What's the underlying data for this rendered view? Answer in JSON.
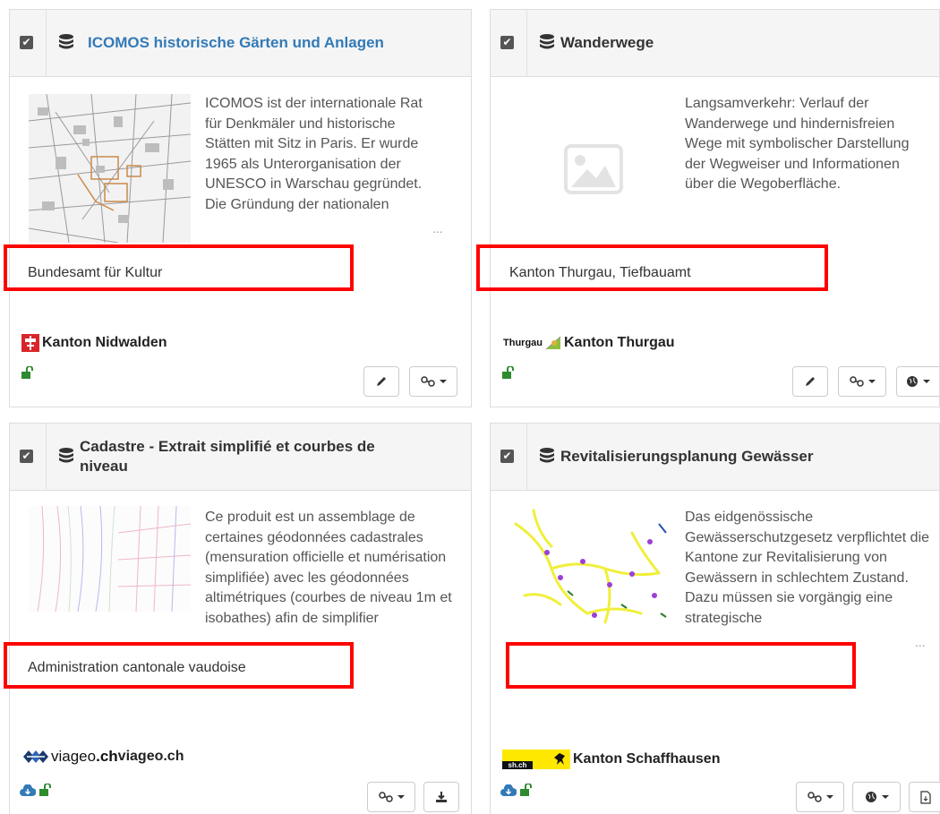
{
  "cards": [
    {
      "title": "ICOMOS historische Gärten und Anlagen",
      "description": "ICOMOS ist der internationale Rat für Denkmäler und historische Stätten mit Sitz in Paris. Er wurde 1965 als Unterorganisation der UNESCO in Warschau gegründet. Die Gründung der nationalen",
      "ellipsis": "...",
      "publisher": "Bundesamt für Kultur",
      "organization": "Kanton Nidwalden"
    },
    {
      "title": "Wanderwege",
      "description": "Langsamverkehr: Verlauf der Wanderwege und hindernisfreien Wege mit symbolischer Darstellung der Wegweiser und Informationen über die Wegoberfläche.",
      "publisher": "Kanton Thurgau, Tiefbauamt",
      "organization_logo_text": "Thurgau",
      "organization": "Kanton Thurgau"
    },
    {
      "title": "Cadastre - Extrait simplifié et courbes de niveau",
      "description": "Ce produit est un assemblage de certaines géodonnées cadastrales (mensuration officielle et numérisation simplifiée) avec les géodonnées altimétriques (courbes de niveau 1m et isobathes) afin de simplifier",
      "publisher": "Administration cantonale vaudoise",
      "organization_logo_text_a": "viageo",
      "organization_logo_text_b": ".ch",
      "organization": "viageo.ch"
    },
    {
      "title": "Revitalisierungsplanung Gewässer",
      "description": "Das eidgenössische Gewässerschutzgesetz verpflichtet die Kantone zur Revitalisierung von Gewässern in schlechtem Zustand. Dazu müssen sie vorgängig eine strategische",
      "ellipsis": "...",
      "publisher": "",
      "organization_logo_text": "sh.ch",
      "organization": "Kanton Schaffhausen"
    }
  ],
  "checkbox_mark": "✔",
  "colors": {
    "link": "#337ab7",
    "highlight": "#ff0000",
    "open_access": "#2e8b2e",
    "download": "#337ab7"
  }
}
